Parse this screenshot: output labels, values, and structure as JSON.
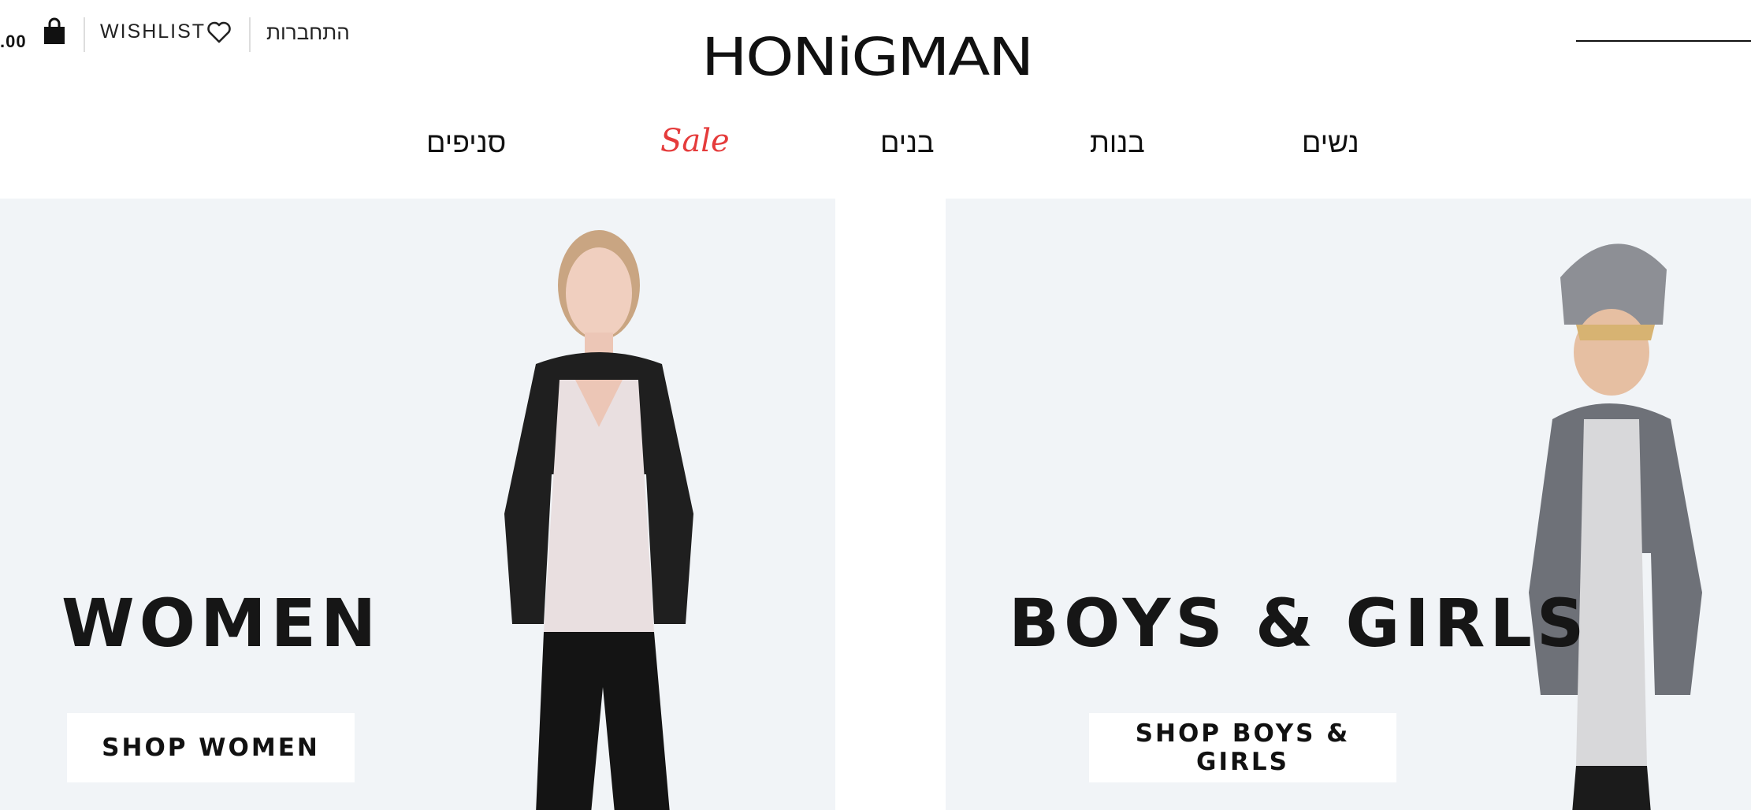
{
  "header": {
    "cart_total": ".00",
    "wishlist_label": "WISHLIST",
    "login_label": "התחברות",
    "logo_text": "HONiGMAN"
  },
  "nav": {
    "women": "נשים",
    "girls": "בנות",
    "boys": "בנים",
    "sale": "Sale",
    "stores": "סניפים"
  },
  "panels": {
    "women": {
      "headline": "WOMEN",
      "cta": "SHOP WOMEN"
    },
    "kids": {
      "headline": "BOYS & GIRLS",
      "cta": "SHOP BOYS & GIRLS"
    }
  },
  "colors": {
    "panel_bg": "#f1f4f7",
    "sale_red": "#e53b3b",
    "text": "#111111"
  },
  "icons": {
    "cart": "shopping-bag-icon",
    "wishlist": "heart-icon"
  }
}
